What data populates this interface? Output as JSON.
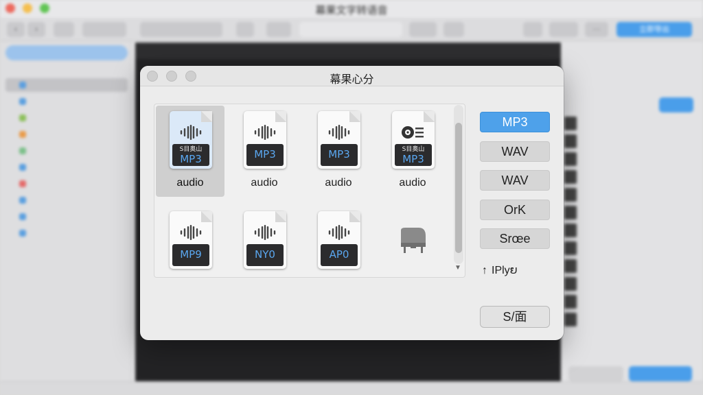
{
  "app": {
    "title": "幕果文字转语音",
    "toolbar_right_button": "立即导出"
  },
  "dialog": {
    "title": "幕果心分",
    "files": [
      {
        "label": "audio",
        "badge": "MP3",
        "badge_small": "S目奥山",
        "icon": "audio-waveform-icon",
        "selected": true
      },
      {
        "label": "audio",
        "badge": "MP3",
        "badge_small": "",
        "icon": "audio-waveform-icon",
        "selected": false
      },
      {
        "label": "audio",
        "badge": "MP3",
        "badge_small": "",
        "icon": "audio-waveform-icon",
        "selected": false
      },
      {
        "label": "audio",
        "badge": "MP3",
        "badge_small": "S目奥山",
        "icon": "cd-disc-icon",
        "selected": false
      },
      {
        "label": "",
        "badge": "MP9",
        "badge_small": "",
        "icon": "audio-waveform-icon",
        "selected": false
      },
      {
        "label": "",
        "badge": "NY0",
        "badge_small": "",
        "icon": "audio-waveform-icon",
        "selected": false
      },
      {
        "label": "",
        "badge": "AP0",
        "badge_small": "",
        "icon": "audio-waveform-icon",
        "selected": false
      },
      {
        "label": "",
        "badge": "",
        "badge_small": "",
        "icon": "piano-icon",
        "selected": false
      }
    ],
    "formats": [
      {
        "label": "MP3",
        "active": true
      },
      {
        "label": "WAV",
        "active": false
      },
      {
        "label": "WAV",
        "active": false
      },
      {
        "label": "OrK",
        "active": false
      },
      {
        "label": "Srœe",
        "active": false
      }
    ],
    "play_label": "IPlyຍ",
    "save_label": "S/面"
  },
  "colors": {
    "accent": "#4ea1ea",
    "badge_bg": "#2b2b2d",
    "badge_text": "#5aa7f0"
  }
}
